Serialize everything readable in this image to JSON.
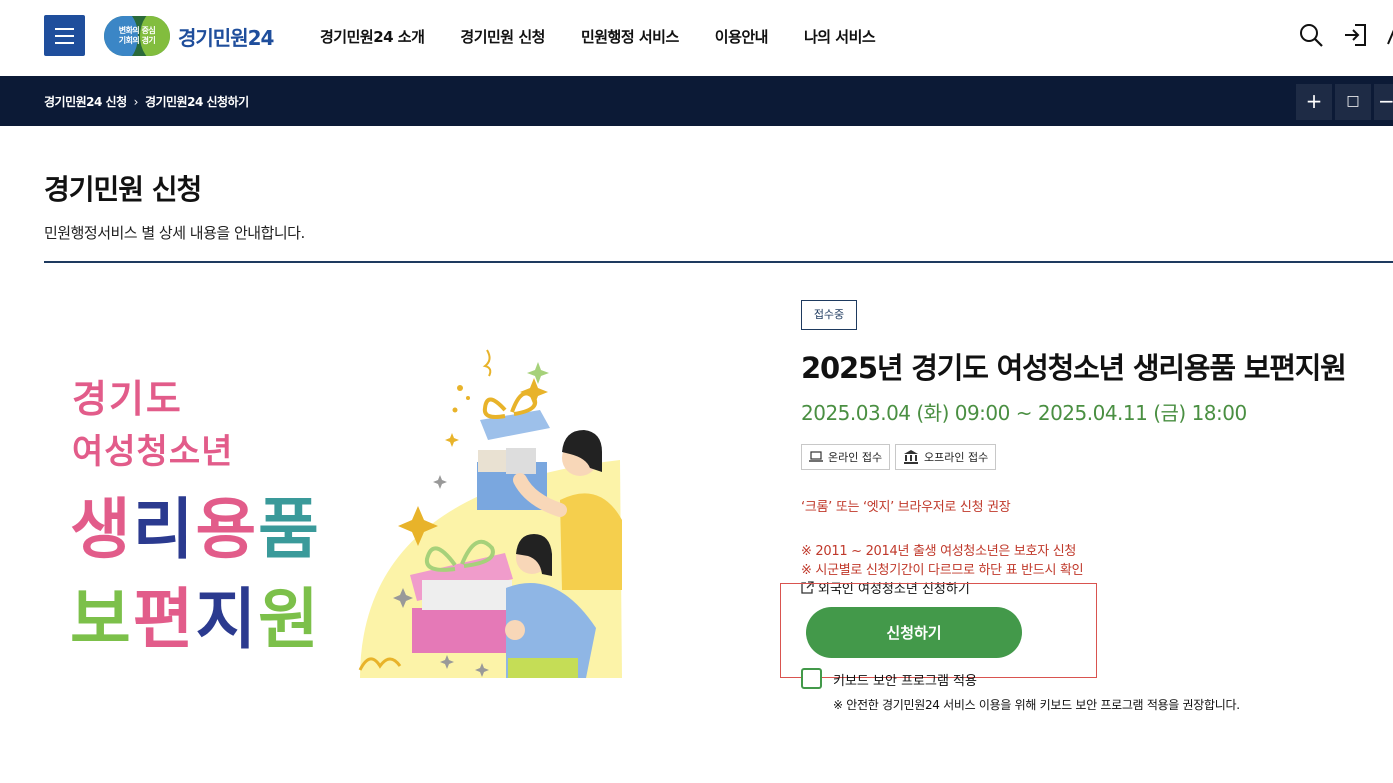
{
  "header": {
    "logo_badge_line1": "변화의 중심",
    "logo_badge_line2": "기회의 경기",
    "logo_text": "경기민원24",
    "nav": [
      "경기민원24 소개",
      "경기민원 신청",
      "민원행정 서비스",
      "이용안내",
      "나의 서비스"
    ]
  },
  "breadcrumb": [
    "경기민원24 신청",
    "경기민원24 신청하기"
  ],
  "page": {
    "title": "경기민원 신청",
    "description": "민원행정서비스 별 상세 내용을 안내합니다."
  },
  "poster": {
    "line1": "경기도",
    "line2": "여성청소년",
    "line3": "생리용품",
    "line4": "보편지원"
  },
  "service": {
    "status": "접수중",
    "title": "2025년 경기도 여성청소년 생리용품 보편지원",
    "period": "2025.03.04 (화) 09:00 ~ 2025.04.11 (금) 18:00",
    "tags": [
      "온라인 접수",
      "오프라인 접수"
    ],
    "browser_notice": "‘크롬’ 또는 ‘엣지’ 브라우저로 신청 권장",
    "notice1": "※ 2011 ~ 2014년 출생 여성청소년은 보호자 신청",
    "notice2": "※ 시군별로 신청기간이 다르므로 하단 표 반드시 확인",
    "foreign_link": "외국인 여성청소년 신청하기",
    "apply_label": "신청하기",
    "keyboard_label": "키보드 보안 프로그램 적용",
    "keyboard_note": "※ 안전한 경기민원24 서비스 이용을 위해 키보드 보안 프로그램 적용을 권장합니다."
  },
  "colors": {
    "brand_blue": "#1f4e9c",
    "dark_bar": "#0c1a36",
    "green": "#43994a",
    "red": "#c0392b"
  }
}
